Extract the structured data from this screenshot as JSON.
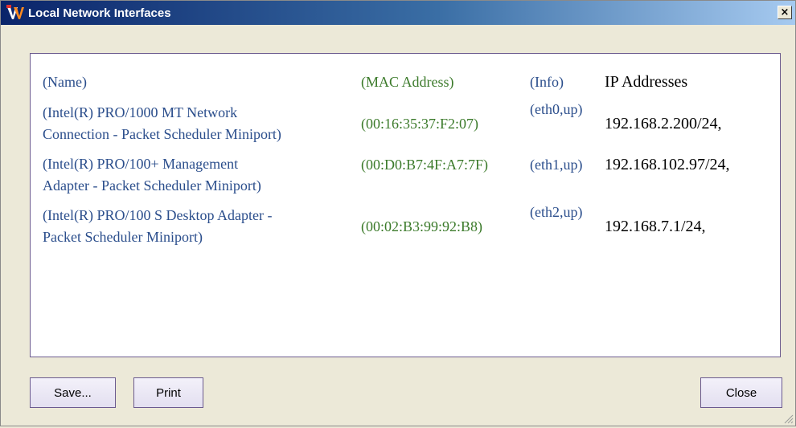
{
  "window": {
    "title": "Local Network Interfaces",
    "close_glyph": "×"
  },
  "icons": {
    "app": "app-logo-icon",
    "close": "close-icon",
    "grip": "resize-grip-icon"
  },
  "colors": {
    "name_text": "#2b4e8c",
    "mac_text": "#3b7a2a",
    "info_text": "#2b4e8c",
    "ip_text": "#000000",
    "panel_border": "#6b5a8e"
  },
  "table": {
    "headers": {
      "name": "(Name)",
      "mac": "(MAC Address)",
      "info": "(Info)",
      "ip": "IP Addresses"
    },
    "rows": [
      {
        "name_line1": "(Intel(R) PRO/1000 MT Network",
        "name_line2": "Connection - Packet Scheduler Miniport)",
        "mac": "(00:16:35:37:F2:07)",
        "info": "(eth0,up)",
        "ip": "192.168.2.200/24,"
      },
      {
        "name_line1": "(Intel(R) PRO/100+ Management",
        "name_line2": "Adapter - Packet Scheduler Miniport)",
        "mac": "(00:D0:B7:4F:A7:7F)",
        "info": "(eth1,up)",
        "ip": "192.168.102.97/24,"
      },
      {
        "name_line1": "(Intel(R) PRO/100 S Desktop Adapter -",
        "name_line2": "Packet Scheduler Miniport)",
        "mac": "(00:02:B3:99:92:B8)",
        "info": "(eth2,up)",
        "ip": "192.168.7.1/24,"
      }
    ]
  },
  "buttons": {
    "save": "Save...",
    "print": "Print",
    "close": "Close"
  }
}
